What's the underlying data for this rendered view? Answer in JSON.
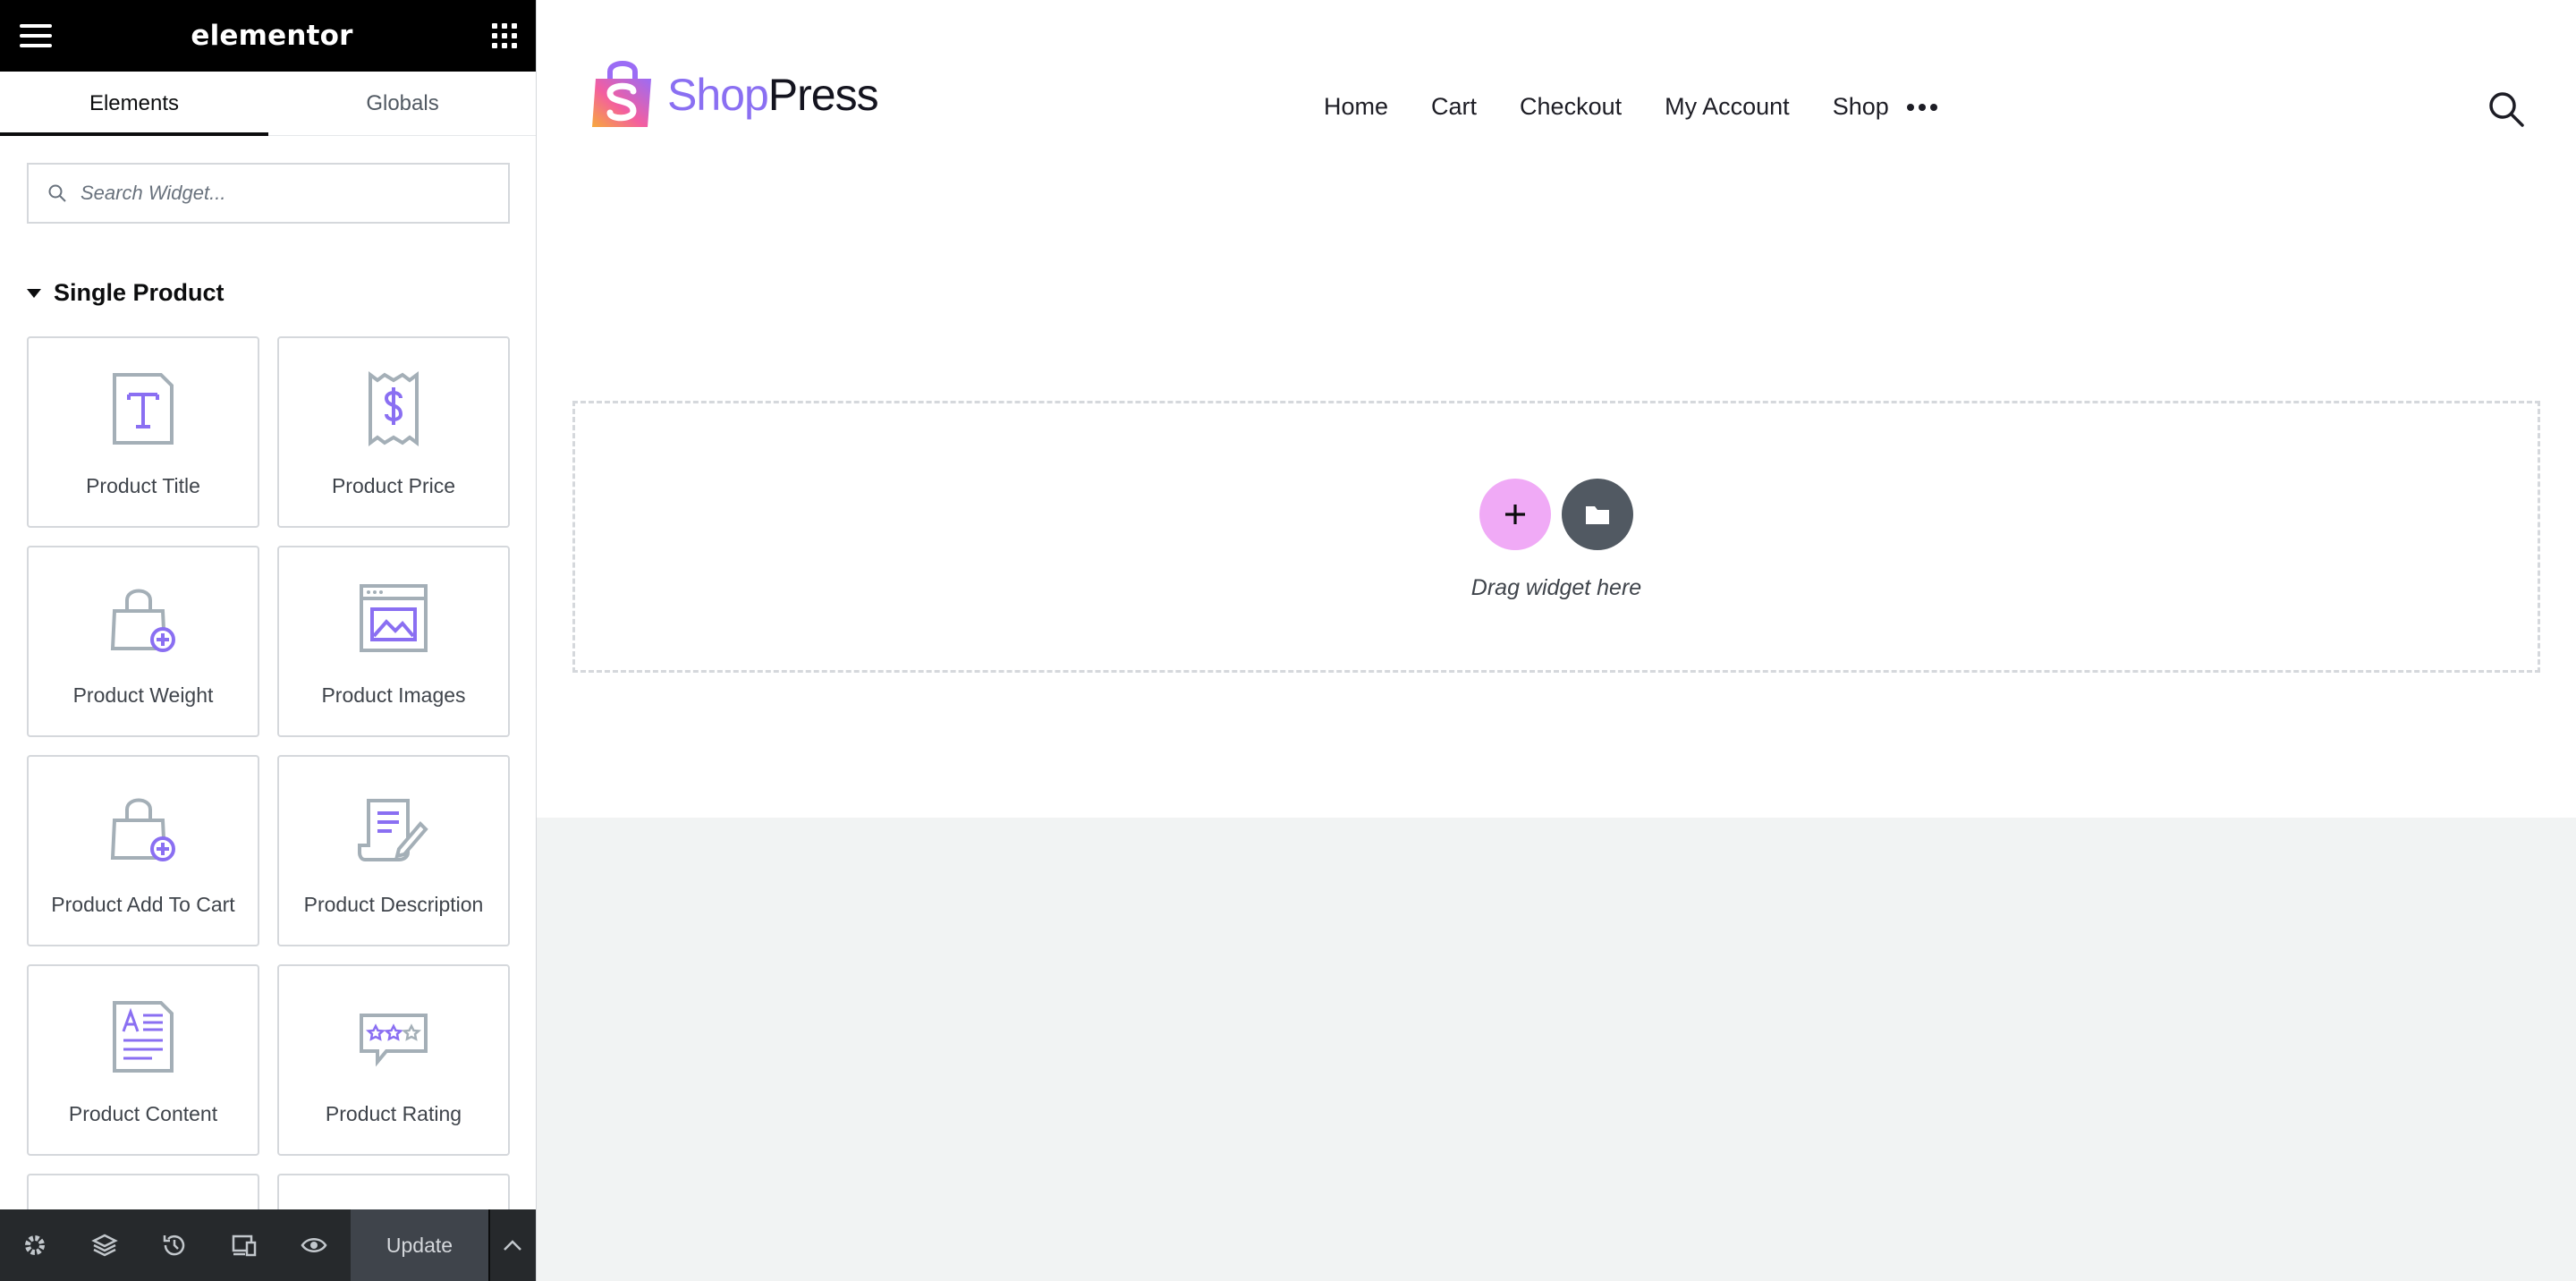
{
  "panel": {
    "header": {
      "brand": "elementor"
    },
    "tabs": [
      {
        "label": "Elements",
        "active": true
      },
      {
        "label": "Globals",
        "active": false
      }
    ],
    "search": {
      "placeholder": "Search Widget..."
    },
    "category": {
      "label": "Single Product"
    },
    "widgets": [
      {
        "label": "Product Title",
        "icon": "text-t-icon"
      },
      {
        "label": "Product Price",
        "icon": "receipt-dollar-icon"
      },
      {
        "label": "Product Weight",
        "icon": "bag-plus-icon"
      },
      {
        "label": "Product Images",
        "icon": "image-window-icon"
      },
      {
        "label": "Product Add To Cart",
        "icon": "bag-plus-icon"
      },
      {
        "label": "Product Description",
        "icon": "document-pen-icon"
      },
      {
        "label": "Product Content",
        "icon": "document-text-icon"
      },
      {
        "label": "Product Rating",
        "icon": "rating-stars-icon"
      }
    ],
    "footer": {
      "icons": [
        "settings-icon",
        "layers-icon",
        "history-icon",
        "responsive-icon",
        "preview-eye-icon"
      ],
      "update_label": "Update"
    }
  },
  "site": {
    "logo": {
      "shop": "Shop",
      "press": "Press"
    },
    "nav": [
      "Home",
      "Cart",
      "Checkout",
      "My Account",
      "Shop"
    ],
    "dropzone": {
      "hint": "Drag widget here"
    }
  },
  "colors": {
    "accent_purple": "#8a6ff2",
    "add_button_pink": "#f0aaf6",
    "panel_dark": "#000000",
    "footer_dark": "#26292c",
    "canvas_bg": "#f1f3f3"
  }
}
